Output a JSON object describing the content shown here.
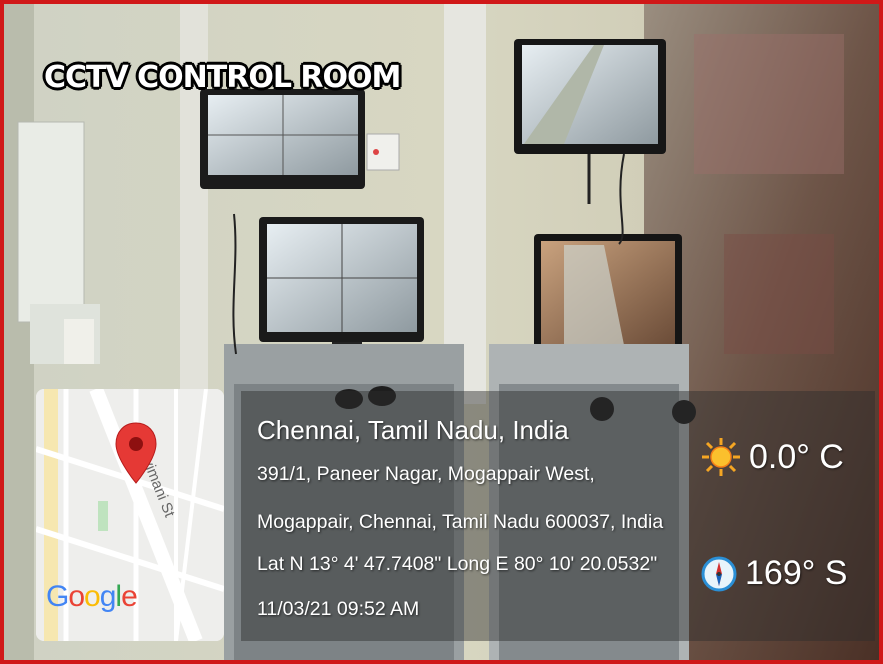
{
  "overlay_title": "CCTV CONTROL ROOM",
  "map": {
    "street_label": "Kavimani St",
    "logo": {
      "letters": [
        "G",
        "o",
        "o",
        "g",
        "l",
        "e"
      ],
      "colors": [
        "#4285F4",
        "#EA4335",
        "#FBBC05",
        "#4285F4",
        "#34A853",
        "#EA4335"
      ]
    },
    "pin_color": "#e53935"
  },
  "location": {
    "place": "Chennai, Tamil Nadu, India",
    "address_line1": "391/1, Paneer Nagar, Mogappair West,",
    "address_line2": "Mogappair, Chennai, Tamil Nadu 600037, India",
    "coordinates": "Lat N 13° 4' 47.7408\" Long E 80° 10' 20.0532\"",
    "datetime": "11/03/21 09:52 AM"
  },
  "weather": {
    "icon": "sun-icon",
    "temperature": "0.0° C"
  },
  "compass": {
    "icon": "compass-icon",
    "bearing": "169° S"
  },
  "colors": {
    "frame": "#d01818",
    "panel": "rgba(45,45,45,0.45)"
  }
}
